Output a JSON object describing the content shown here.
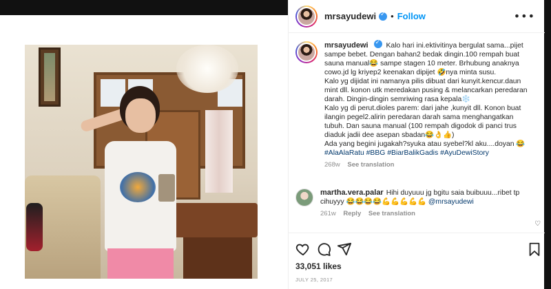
{
  "header": {
    "username": "mrsayudewi",
    "follow_label": "Follow",
    "separator": "•",
    "more_label": "•••"
  },
  "caption": {
    "username": "mrsayudewi",
    "lines": [
      "Kalo hari ini.ektivitinya bergulat sama...pijet",
      "sampe bebet. Dengan bahan2 bedak dingin.100 rempah buat",
      "sauna manual😂 sampe stagen 10 meter. Brhubung anaknya",
      "cowo.jd lg kriyep2 keenakan dipijet 🤣nya minta susu.",
      "Kalo yg dijidat ini namanya pilis dibuat dari kunyit.kencur.daun",
      "mint dll. konon utk meredakan pusing & melancarkan peredaran",
      "darah. Dingin-dingin semriwing rasa kepala❄️",
      "Kalo yg di perut.dioles parem: dari jahe ,kunyit dll. Konon buat",
      "ilangin pegel2.alirin peredaran darah sama menghangatkan",
      "tubuh. Dan sauna manual (100 rempah digodok di panci trus",
      "diaduk jadii dee asepan sbadan😂👌👍)",
      "Ada yang begini jugakah?syuka atau syebel?kl aku....doyan 😂"
    ],
    "hashtags": "#AlaAlaRatu #BBG #BiarBalikGadis #AyuDewiStory",
    "age": "268w",
    "see_translation": "See translation"
  },
  "reply": {
    "username": "martha.vera.palar",
    "text_line1": "Hihi duyuuu jg bgitu saia buibuuu...ribet tp",
    "text_line2": "cihuyyy 😂😂😂😂💪💪💪💪💪 ",
    "mention": "@mrsayudewi",
    "age": "261w",
    "reply_label": "Reply",
    "see_translation": "See translation",
    "heart": "♡"
  },
  "stats": {
    "likes": "33,051 likes",
    "date": "JULY 25, 2017"
  },
  "icons": {
    "like": "heart-icon",
    "comment": "comment-icon",
    "share": "share-icon",
    "save": "bookmark-icon",
    "more": "more-icon",
    "verified": "verified-badge-icon"
  },
  "colors": {
    "link_blue": "#0095f6",
    "hashtag": "#00376b",
    "muted": "#8e8e8e",
    "text": "#262626"
  }
}
